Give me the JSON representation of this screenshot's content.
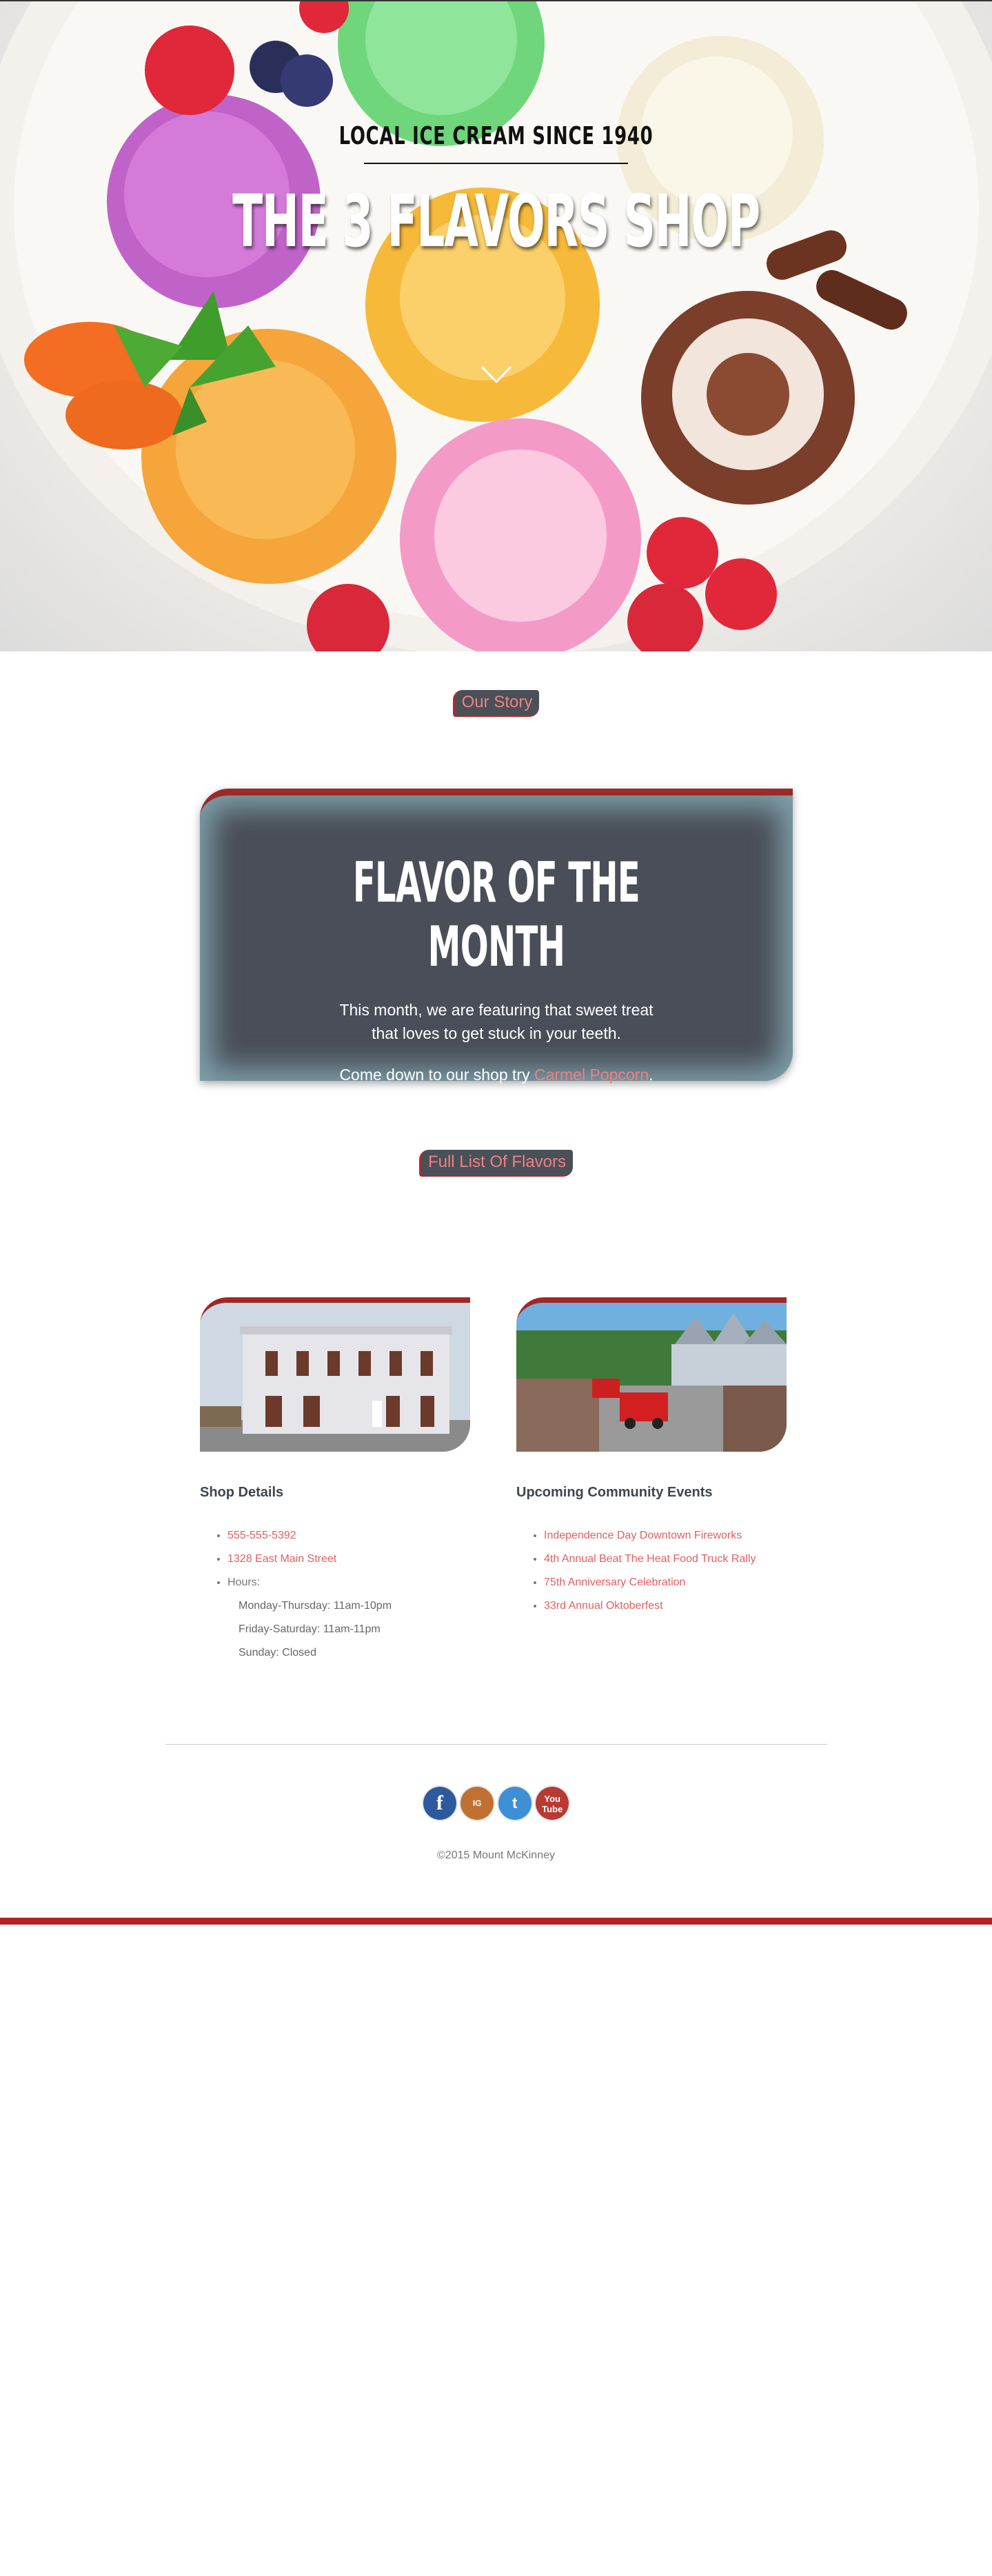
{
  "hero": {
    "tagline": "LOCAL ICE CREAM SINCE 1940",
    "title": "THE 3 FLAVORS SHOP"
  },
  "nav": {
    "our_story": "Our Story",
    "full_list": "Full List Of Flavors"
  },
  "feature": {
    "title": "FLAVOR OF THE MONTH",
    "line1": "This month, we are featuring that sweet treat",
    "line2": "that loves to get stuck in your teeth.",
    "cta_prefix": "Come down to our shop try ",
    "cta_link": "Carmel Popcorn",
    "cta_suffix": "."
  },
  "shop": {
    "title": "Shop Details",
    "phone": "555-555-5392",
    "address": "1328 East Main Street",
    "hours_label": "Hours:",
    "hours": [
      "Monday-Thursday: 11am-10pm",
      "Friday-Saturday: 11am-11pm",
      "Sunday: Closed"
    ]
  },
  "events": {
    "title": "Upcoming Community Events",
    "items": [
      "Independence Day Downtown Fireworks",
      "4th Annual Beat The Heat Food Truck Rally",
      "75th Anniversary Celebration",
      "33rd Annual Oktoberfest"
    ]
  },
  "social": {
    "facebook_glyph": "f",
    "instagram_glyph": "IG",
    "twitter_glyph": "t",
    "youtube_glyph_1": "You",
    "youtube_glyph_2": "Tube"
  },
  "footer": {
    "copyright": "©2015 Mount McKinney"
  },
  "colors": {
    "accent_red": "#b22222",
    "link_pink": "#f08080",
    "card_bg": "#494e58"
  }
}
